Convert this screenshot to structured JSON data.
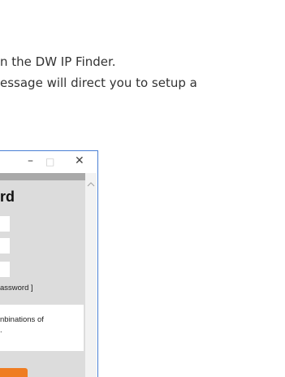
{
  "document": {
    "line1": "n the DW IP Finder.",
    "line2": "essage will direct you to setup a"
  },
  "window": {
    "controls": {
      "minimize": "–",
      "maximize": "□",
      "close": "✕"
    },
    "scroll_up_icon": "chevron-up-icon",
    "heading": "rd",
    "fields": [
      "",
      "",
      ""
    ],
    "hint": "assword ]",
    "info": {
      "line1": "nbinations of",
      "line2": "."
    },
    "accent_color": "#ef7d22"
  }
}
